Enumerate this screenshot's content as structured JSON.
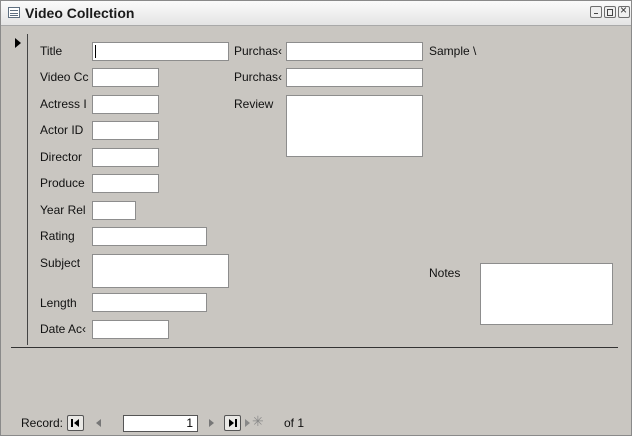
{
  "window": {
    "title": "Video Collection"
  },
  "form": {
    "labels": {
      "title": "Title",
      "video_code": "Video Cc",
      "actress": "Actress I",
      "actor_id": "Actor ID",
      "director": "Director",
      "producer": "Produce",
      "year_released": "Year Rel",
      "rating": "Rating",
      "subject": "Subject",
      "length": "Length",
      "date_acquired": "Date Ac‹",
      "purchase_1": "Purchas‹",
      "purchase_2": "Purchas‹",
      "review": "Review",
      "sample": "Sample \\",
      "notes": "Notes"
    },
    "values": {
      "title": "",
      "video_code": "",
      "actress": "",
      "actor_id": "",
      "director": "",
      "producer": "",
      "year_released": "",
      "rating": "",
      "subject": "",
      "length": "",
      "date_acquired": "",
      "purchase_1": "",
      "purchase_2": "",
      "review": "",
      "notes": ""
    }
  },
  "navigator": {
    "label": "Record:",
    "current": "1",
    "of_text": "of 1"
  },
  "icons": [
    "form-icon",
    "minimize-icon",
    "maximize-icon",
    "close-icon",
    "record-selector-icon",
    "first-record-icon",
    "previous-record-icon",
    "next-record-icon",
    "last-record-icon",
    "new-record-icon"
  ]
}
